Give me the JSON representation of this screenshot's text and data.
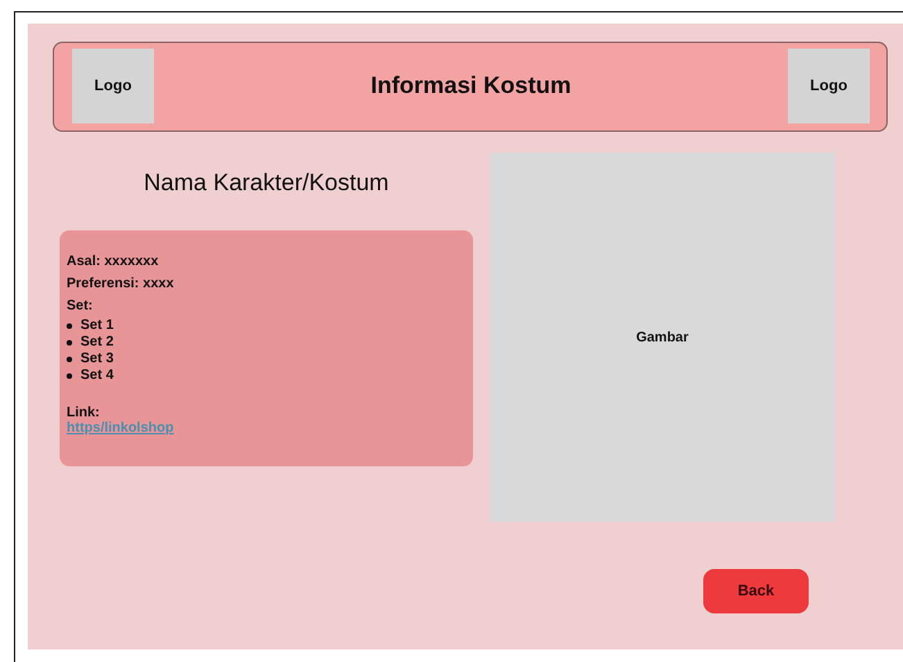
{
  "header": {
    "logo_left": "Logo",
    "title": "Informasi Kostum",
    "logo_right": "Logo"
  },
  "character_title": "Nama Karakter/Kostum",
  "info": {
    "origin": "Asal: xxxxxxx",
    "preference": "Preferensi: xxxx",
    "set_label": "Set:",
    "sets": [
      "Set 1",
      "Set 2",
      "Set 3",
      "Set 4"
    ],
    "link_label": "Link:",
    "link": "https/linkolshop"
  },
  "image_placeholder": "Gambar",
  "buttons": [
    "Back"
  ]
}
